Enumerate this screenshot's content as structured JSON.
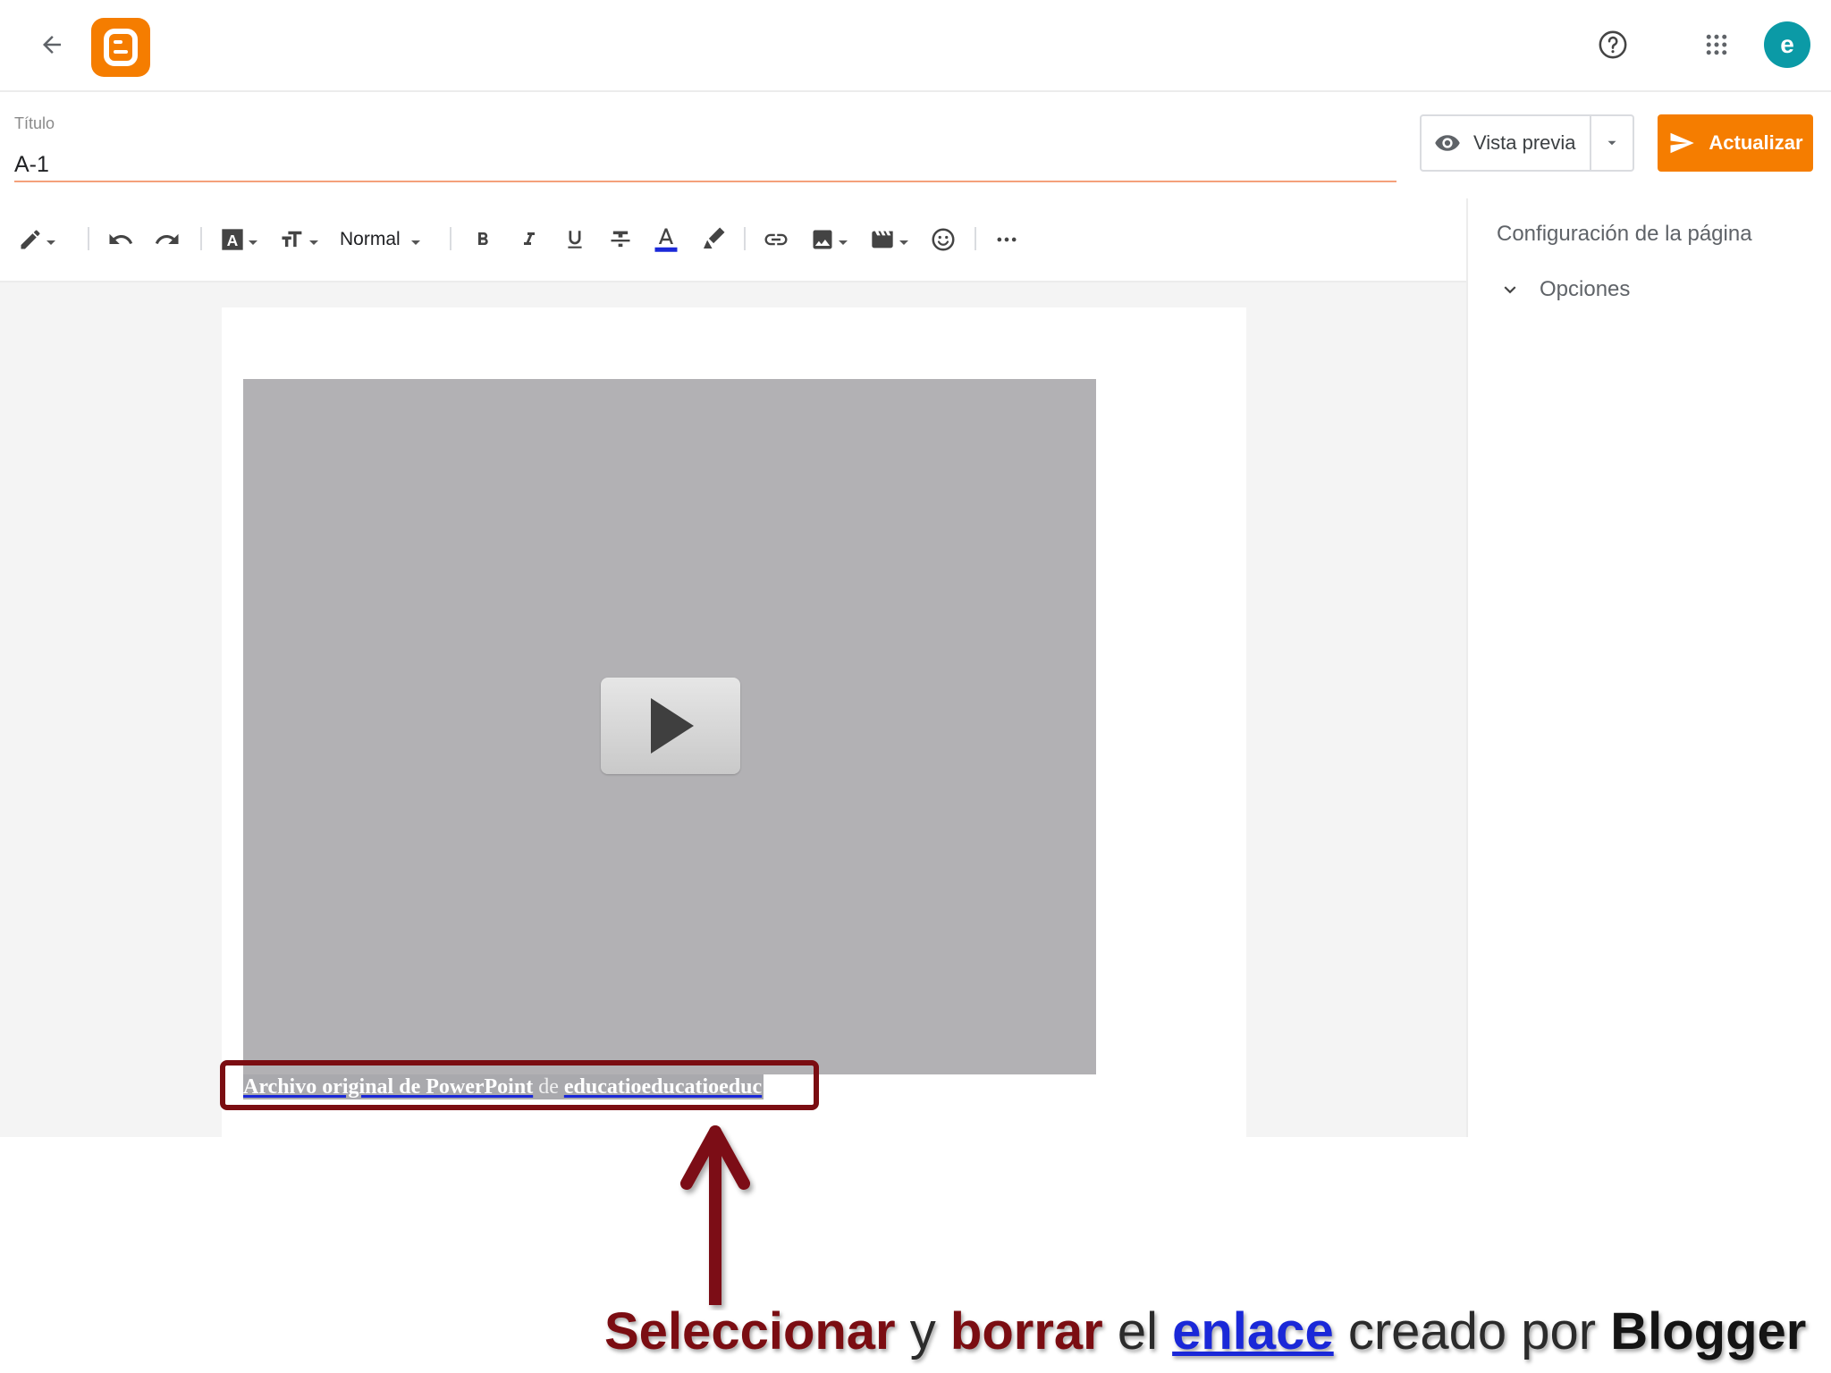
{
  "header": {
    "back_icon": "arrow-left-icon",
    "logo_icon": "blogger-logo-icon",
    "help_icon": "help-circle-icon",
    "apps_icon": "apps-grid-icon",
    "avatar_letter": "e",
    "avatar_color": "#0b9aa6",
    "brand_color": "#f57d00"
  },
  "title": {
    "label": "Título",
    "value": "A-1"
  },
  "actions": {
    "preview_label": "Vista previa",
    "update_label": "Actualizar"
  },
  "toolbar": {
    "paragraph_style": "Normal",
    "items": [
      "pencil-icon",
      "undo-icon",
      "redo-icon",
      "font-icon",
      "font-size-icon",
      "bold-icon",
      "italic-icon",
      "underline-icon",
      "strikethrough-icon",
      "text-color-icon",
      "highlight-icon",
      "link-icon",
      "image-icon",
      "video-icon",
      "emoji-icon",
      "more-icon"
    ]
  },
  "editor": {
    "caption_link_1": "Archivo original de PowerPoint",
    "caption_separator": "de",
    "caption_link_2": "educatioeducatioeduc"
  },
  "sidebar": {
    "title": "Configuración de la página",
    "options_label": "Opciones"
  },
  "annotation": {
    "word_1": "Seleccionar",
    "word_2": "y",
    "word_3": "borrar",
    "word_4": "el",
    "word_5": "enlace",
    "word_6": "creado por",
    "word_7": "Blogger",
    "accent_color": "#7b0d12"
  }
}
